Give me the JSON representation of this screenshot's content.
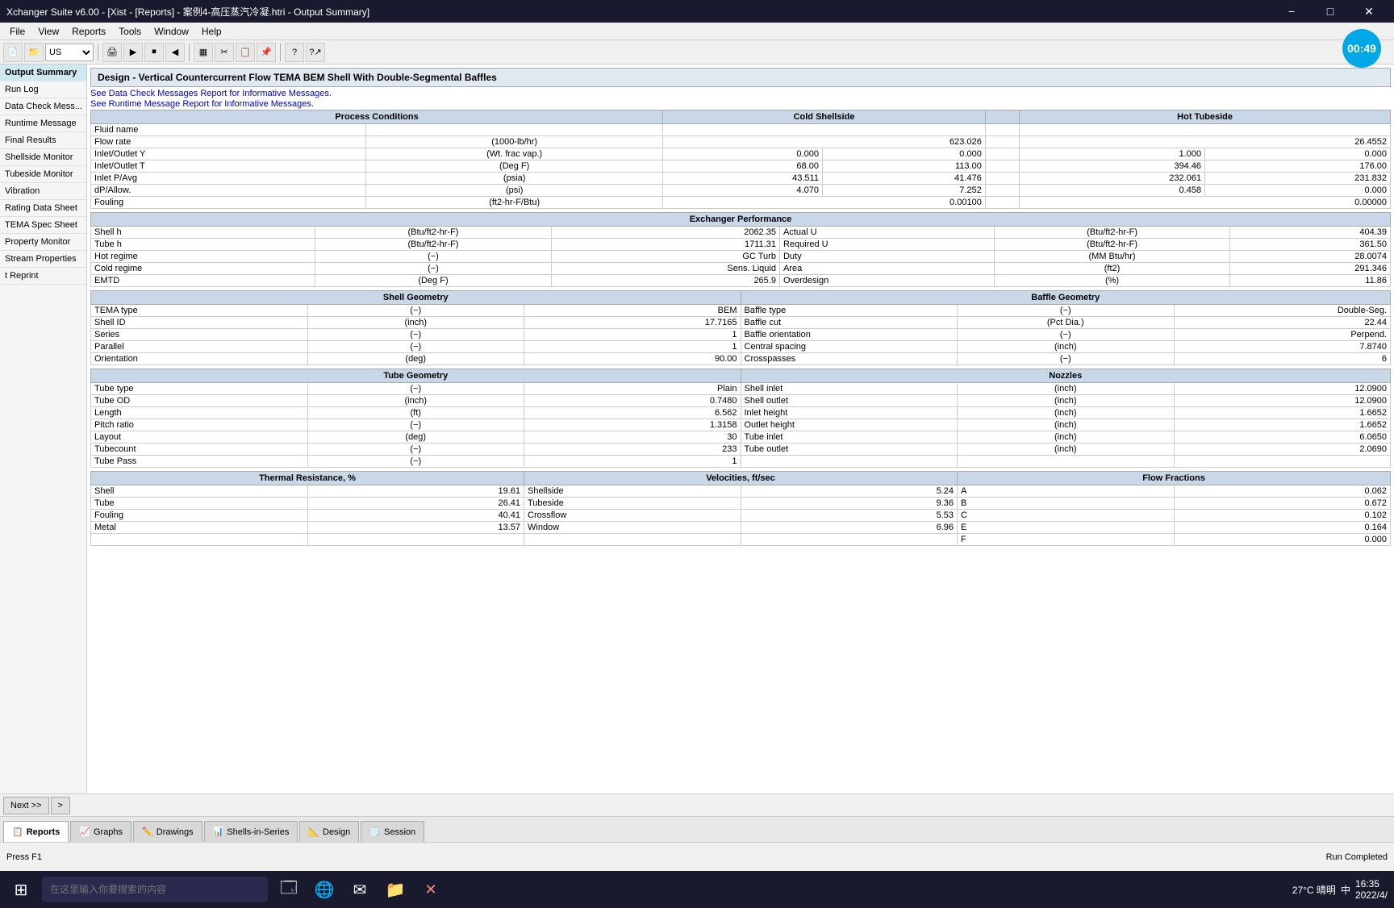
{
  "titleBar": {
    "title": "Xchanger Suite v6.00 - [Xist - [Reports] - 案例4-高压蒸汽冷凝.htri - Output Summary]",
    "minimize": "−",
    "maximize": "□",
    "close": "✕"
  },
  "menuBar": {
    "items": [
      "File",
      "View",
      "Reports",
      "Tools",
      "Window",
      "Help"
    ]
  },
  "toolbar": {
    "units": "US"
  },
  "timer": "00:49",
  "sidebar": {
    "items": [
      {
        "label": "Output Summary",
        "active": true
      },
      {
        "label": "Run Log",
        "active": false
      },
      {
        "label": "Data Check Mess...",
        "active": false
      },
      {
        "label": "Runtime Message",
        "active": false
      },
      {
        "label": "Final Results",
        "active": false
      },
      {
        "label": "Shellside Monitor",
        "active": false
      },
      {
        "label": "Tubeside Monitor",
        "active": false
      },
      {
        "label": "Vibration",
        "active": false
      },
      {
        "label": "Rating Data Sheet",
        "active": false
      },
      {
        "label": "TEMA Spec Sheet",
        "active": false
      },
      {
        "label": "Property Monitor",
        "active": false
      },
      {
        "label": "Stream Properties",
        "active": false
      },
      {
        "label": "t Reprint",
        "active": false
      }
    ]
  },
  "report": {
    "designLine": "Design - Vertical Countercurrent Flow TEMA BEM Shell With Double-Segmental Baffles",
    "dataCheckLink": "See Data Check Messages Report for Informative Messages.",
    "runtimeLink": "See Runtime Message Report for Informative Messages.",
    "processConditions": {
      "header": "Process Conditions",
      "coldShellside": "Cold Shellside",
      "hotTubeside": "Hot Tubeside",
      "rows": [
        {
          "label": "Fluid name",
          "unit": "",
          "cold": "",
          "hot": ""
        },
        {
          "label": "Flow rate",
          "unit": "(1000-lb/hr)",
          "cold": "623.026",
          "hot": "26.4552"
        },
        {
          "label": "Inlet/Outlet Y",
          "unit": "(Wt. frac vap.)",
          "cold": "0.000",
          "cold2": "0.000",
          "hot": "1.000",
          "hot2": "0.000"
        },
        {
          "label": "Inlet/Outlet T",
          "unit": "(Deg F)",
          "cold": "68.00",
          "cold2": "113.00",
          "hot": "394.46",
          "hot2": "176.00"
        },
        {
          "label": "Inlet P/Avg",
          "unit": "(psia)",
          "cold": "43.511",
          "cold2": "41.476",
          "hot": "232.061",
          "hot2": "231.832"
        },
        {
          "label": "dP/Allow.",
          "unit": "(psi)",
          "cold": "4.070",
          "cold2": "7.252",
          "hot": "0.458",
          "hot2": "0.000"
        },
        {
          "label": "Fouling",
          "unit": "(ft2-hr-F/Btu)",
          "cold": "0.00100",
          "hot": "0.00000"
        }
      ]
    },
    "exchangerPerformance": {
      "header": "Exchanger Performance",
      "rows": [
        {
          "left": "Shell h",
          "leftUnit": "(Btu/ft2-hr-F)",
          "leftVal": "2062.35",
          "right": "Actual U",
          "rightUnit": "(Btu/ft2-hr-F)",
          "rightVal": "404.39"
        },
        {
          "left": "Tube h",
          "leftUnit": "(Btu/ft2-hr-F)",
          "leftVal": "1711.31",
          "right": "Required U",
          "rightUnit": "(Btu/ft2-hr-F)",
          "rightVal": "361.50"
        },
        {
          "left": "Hot regime",
          "leftUnit": "(−)",
          "leftVal": "GC Turb",
          "right": "Duty",
          "rightUnit": "(MM Btu/hr)",
          "rightVal": "28.0074"
        },
        {
          "left": "Cold regime",
          "leftUnit": "(−)",
          "leftVal": "Sens. Liquid",
          "right": "Area",
          "rightUnit": "(ft2)",
          "rightVal": "291.346"
        },
        {
          "left": "EMTD",
          "leftUnit": "(Deg F)",
          "leftVal": "265.9",
          "right": "Overdesign",
          "rightUnit": "(%)",
          "rightVal": "11.86"
        }
      ]
    },
    "shellGeometry": {
      "header": "Shell Geometry",
      "rows": [
        {
          "label": "TEMA type",
          "unit": "(−)",
          "val": "BEM"
        },
        {
          "label": "Shell ID",
          "unit": "(inch)",
          "val": "17.7165"
        },
        {
          "label": "Series",
          "unit": "(−)",
          "val": "1"
        },
        {
          "label": "Parallel",
          "unit": "(−)",
          "val": "1"
        },
        {
          "label": "Orientation",
          "unit": "(deg)",
          "val": "90.00"
        }
      ]
    },
    "baffleGeometry": {
      "header": "Baffle Geometry",
      "rows": [
        {
          "label": "Baffle type",
          "unit": "(−)",
          "val": "Double-Seg."
        },
        {
          "label": "Baffle cut",
          "unit": "(Pct Dia.)",
          "val": "22.44"
        },
        {
          "label": "Baffle orientation",
          "unit": "(−)",
          "val": "Perpend."
        },
        {
          "label": "Central spacing",
          "unit": "(inch)",
          "val": "7.8740"
        },
        {
          "label": "Crosspasses",
          "unit": "(−)",
          "val": "6"
        }
      ]
    },
    "tubeGeometry": {
      "header": "Tube Geometry",
      "rows": [
        {
          "label": "Tube type",
          "unit": "(−)",
          "val": "Plain"
        },
        {
          "label": "Tube OD",
          "unit": "(inch)",
          "val": "0.7480"
        },
        {
          "label": "Length",
          "unit": "(ft)",
          "val": "6.562"
        },
        {
          "label": "Pitch ratio",
          "unit": "(−)",
          "val": "1.3158"
        },
        {
          "label": "Layout",
          "unit": "(deg)",
          "val": "30"
        },
        {
          "label": "Tubecount",
          "unit": "(−)",
          "val": "233"
        },
        {
          "label": "Tube Pass",
          "unit": "(−)",
          "val": "1"
        }
      ]
    },
    "nozzles": {
      "header": "Nozzles",
      "rows": [
        {
          "label": "Shell inlet",
          "unit": "(inch)",
          "val": "12.0900"
        },
        {
          "label": "Shell outlet",
          "unit": "(inch)",
          "val": "12.0900"
        },
        {
          "label": "Inlet height",
          "unit": "(inch)",
          "val": "1.6652"
        },
        {
          "label": "Outlet height",
          "unit": "(inch)",
          "val": "1.6652"
        },
        {
          "label": "Tube inlet",
          "unit": "(inch)",
          "val": "6.0650"
        },
        {
          "label": "Tube outlet",
          "unit": "(inch)",
          "val": "2.0690"
        }
      ]
    },
    "thermalResistance": {
      "header": "Thermal Resistance, %",
      "rows": [
        {
          "label": "Shell",
          "val": "19.61"
        },
        {
          "label": "Tube",
          "val": "26.41"
        },
        {
          "label": "Fouling",
          "val": "40.41"
        },
        {
          "label": "Metal",
          "val": "13.57"
        }
      ]
    },
    "velocities": {
      "header": "Velocities, ft/sec",
      "rows": [
        {
          "label": "Shellside",
          "val": "5.24"
        },
        {
          "label": "Tubeside",
          "val": "9.36"
        },
        {
          "label": "Crossflow",
          "val": "5.53"
        },
        {
          "label": "Window",
          "val": "6.96"
        }
      ]
    },
    "flowFractions": {
      "header": "Flow Fractions",
      "rows": [
        {
          "label": "A",
          "val": "0.062"
        },
        {
          "label": "B",
          "val": "0.672"
        },
        {
          "label": "C",
          "val": "0.102"
        },
        {
          "label": "E",
          "val": "0.164"
        },
        {
          "label": "F",
          "val": "0.000"
        }
      ]
    }
  },
  "bottomNav": {
    "nextLabel": "Next >>",
    "arrowLabel": ">"
  },
  "tabs": [
    {
      "label": "Reports",
      "icon": "📋",
      "active": true
    },
    {
      "label": "Graphs",
      "icon": "📈",
      "active": false
    },
    {
      "label": "Drawings",
      "icon": "✏️",
      "active": false
    },
    {
      "label": "Shells-in-Series",
      "icon": "📊",
      "active": false
    },
    {
      "label": "Design",
      "icon": "📐",
      "active": false
    },
    {
      "label": "Session",
      "icon": "🗒️",
      "active": false
    }
  ],
  "statusBar": {
    "pressKey": "Press F1",
    "status": "Run Completed"
  },
  "taskbar": {
    "searchPlaceholder": "在这里输入你要搜索的内容",
    "time": "16:35",
    "date": "2022/4/",
    "weather": "27°C 晴明",
    "lang": "中"
  }
}
